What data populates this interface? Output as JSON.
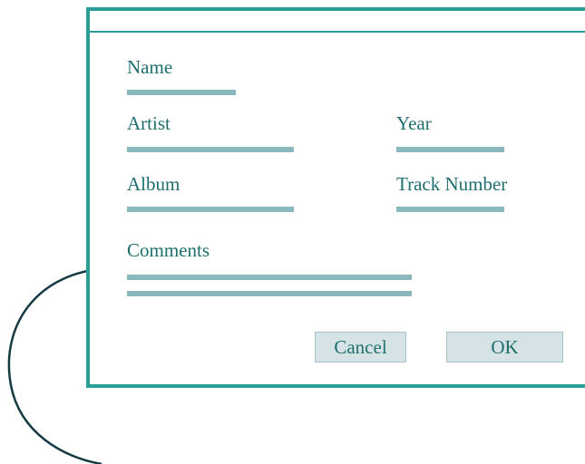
{
  "form": {
    "name_label": "Name",
    "artist_label": "Artist",
    "year_label": "Year",
    "album_label": "Album",
    "track_label": "Track Number",
    "comments_label": "Comments"
  },
  "buttons": {
    "cancel_label": "Cancel",
    "ok_label": "OK"
  },
  "colors": {
    "frame": "#2a9d96",
    "label_text": "#1f6e6e",
    "field_line": "#8ab8bf",
    "button_bg": "#d6e3e6",
    "arrow": "#163a44"
  },
  "icons": {
    "arrow": "curved-arrow-icon"
  }
}
